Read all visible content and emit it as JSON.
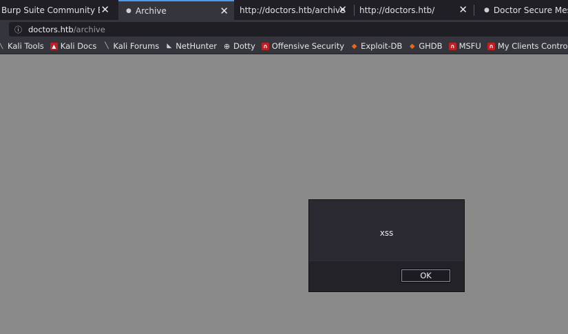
{
  "tabs": [
    {
      "title": "Burp Suite Community Editio",
      "close": "✕"
    },
    {
      "title": "Archive",
      "close": "✕",
      "active": true
    },
    {
      "title": "http://doctors.htb/archive",
      "close": "✕"
    },
    {
      "title": "http://doctors.htb/",
      "close": "✕"
    },
    {
      "title": "Doctor Secure Messag"
    }
  ],
  "urlbar": {
    "host": "doctors.htb",
    "path": "/archive",
    "info_icon": "info-icon"
  },
  "bookmarks": [
    {
      "label": "Kali Tools",
      "icon": "kali-dragon-icon"
    },
    {
      "label": "Kali Docs",
      "icon": "kali-docs-icon"
    },
    {
      "label": "Kali Forums",
      "icon": "kali-forums-icon"
    },
    {
      "label": "NetHunter",
      "icon": "nethunter-icon"
    },
    {
      "label": "Dotty",
      "icon": "globe-icon"
    },
    {
      "label": "Offensive Security",
      "icon": "offsec-icon"
    },
    {
      "label": "Exploit-DB",
      "icon": "exploit-db-icon"
    },
    {
      "label": "GHDB",
      "icon": "ghdb-icon"
    },
    {
      "label": "MSFU",
      "icon": "msfu-icon"
    },
    {
      "label": "My Clients Control Pan...",
      "icon": "offsec-icon"
    }
  ],
  "dialog": {
    "message": "xss",
    "ok_label": "OK"
  },
  "colors": {
    "tab_active_accent": "#4d9bf0",
    "page_background": "#8a8a8a"
  }
}
